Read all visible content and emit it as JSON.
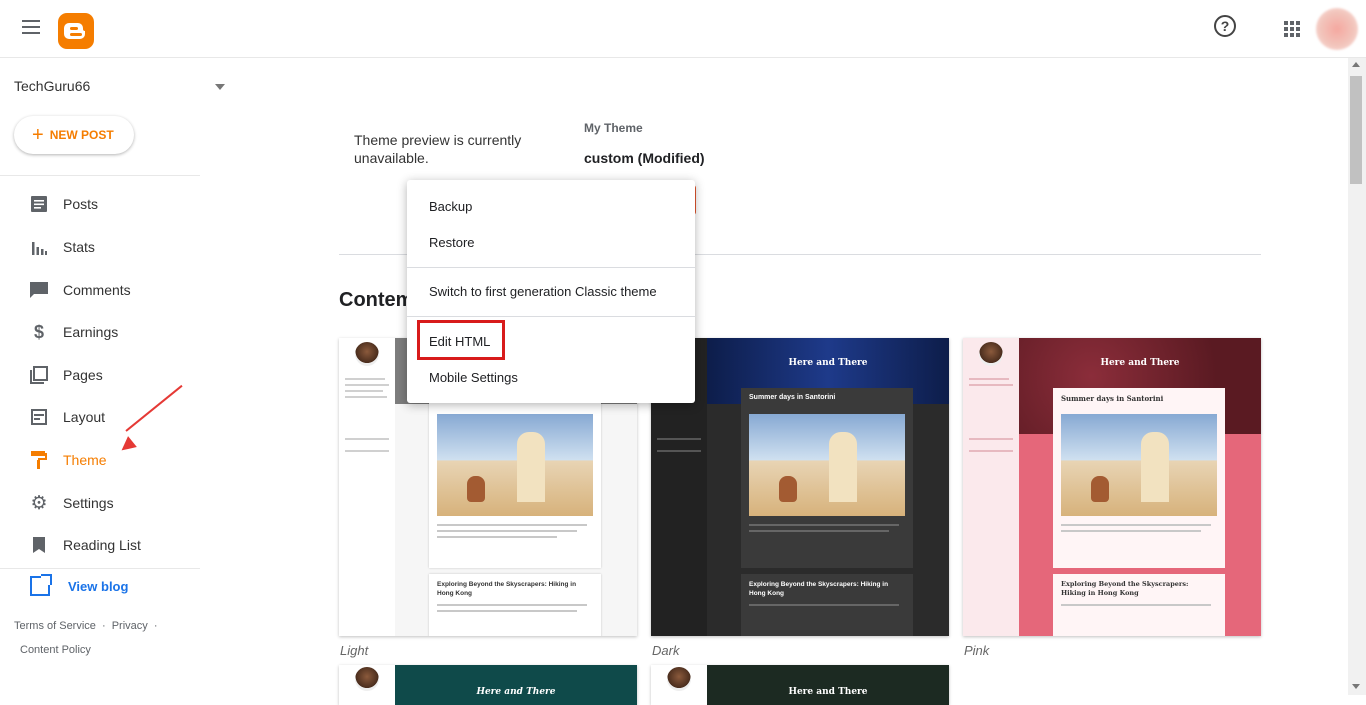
{
  "app": {
    "name": "Blogger",
    "brand_color": "#f57d00",
    "icons": [
      "menu-icon",
      "blogger-logo",
      "help-icon",
      "apps-icon",
      "account-avatar"
    ]
  },
  "header": {
    "help_glyph": "?"
  },
  "sidebar": {
    "blog_name": "TechGuru66",
    "new_post_label": "NEW POST",
    "items": [
      {
        "label": "Posts",
        "icon": "posts-icon"
      },
      {
        "label": "Stats",
        "icon": "stats-icon"
      },
      {
        "label": "Comments",
        "icon": "comments-icon"
      },
      {
        "label": "Earnings",
        "icon": "dollar-icon"
      },
      {
        "label": "Pages",
        "icon": "pages-icon"
      },
      {
        "label": "Layout",
        "icon": "layout-icon"
      },
      {
        "label": "Theme",
        "icon": "theme-roller-icon",
        "active": true
      },
      {
        "label": "Settings",
        "icon": "gear-icon"
      },
      {
        "label": "Reading List",
        "icon": "bookmark-icon"
      }
    ],
    "view_blog_label": "View blog",
    "footer": {
      "terms": "Terms of Service",
      "privacy": "Privacy",
      "content_policy": "Content Policy",
      "dot": "·"
    }
  },
  "main": {
    "preview_unavailable": "Theme preview is currently unavailable.",
    "my_theme_label": "My Theme",
    "my_theme_name": "custom (Modified)",
    "section_title": "Contemporary",
    "themes": [
      {
        "label": "Light",
        "blog_title": "",
        "post1_title": "",
        "post2_title": "Exploring Beyond the Skyscrapers: Hiking in Hong Kong"
      },
      {
        "label": "Dark",
        "blog_title": "Here and There",
        "post1_title": "Summer days in Santorini",
        "post2_title": "Exploring Beyond the Skyscrapers: Hiking in Hong Kong"
      },
      {
        "label": "Pink",
        "blog_title": "Here and There",
        "post1_title": "Summer days in Santorini",
        "post2_title": "Exploring Beyond the Skyscrapers: Hiking in Hong Kong"
      }
    ],
    "second_row_titles": [
      "Here and There",
      "Here and There"
    ]
  },
  "menu": {
    "items": [
      "Backup",
      "Restore",
      "Switch to first generation Classic theme",
      "Edit HTML",
      "Mobile Settings"
    ],
    "highlighted": "Edit HTML"
  },
  "colors": {
    "annotation_red": "#e53935",
    "dark_theme_bg": "#303030",
    "pink_theme_accent": "#e5677a",
    "pink_theme_header": "#5a1a22"
  }
}
